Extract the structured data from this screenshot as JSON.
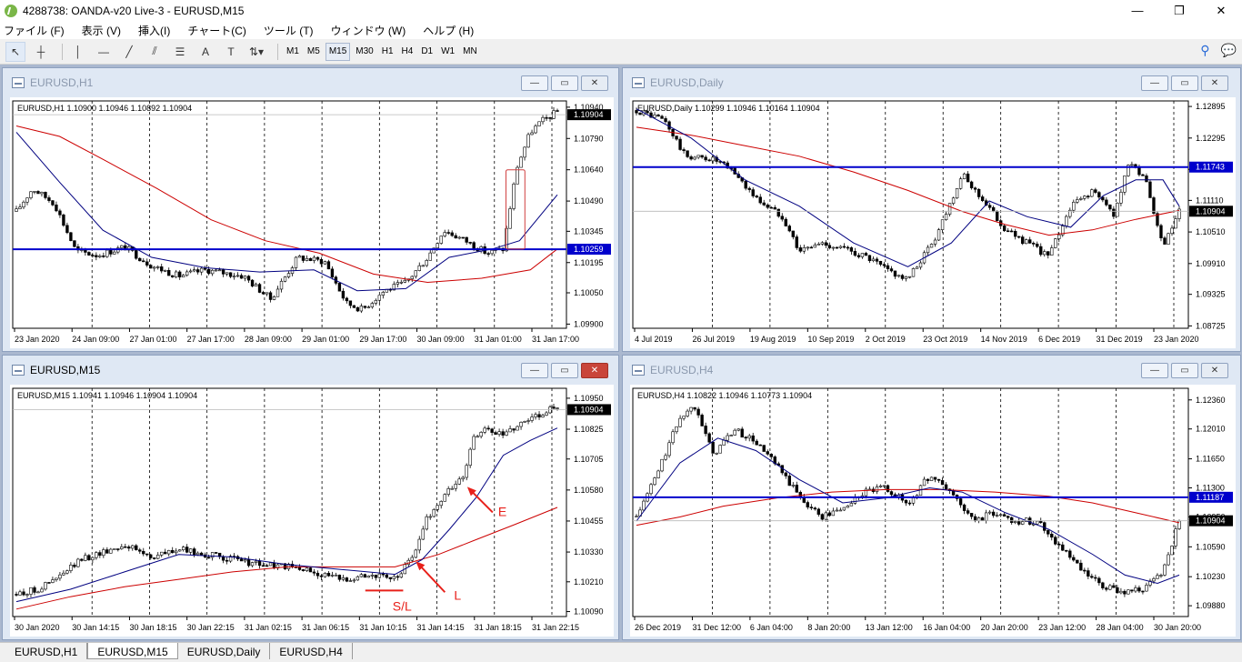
{
  "app": {
    "title": "4288738: OANDA-v20 Live-3 - EURUSD,M15",
    "win_min": "—",
    "win_max": "❐",
    "win_close": "✕"
  },
  "menu": [
    "ファイル (F)",
    "表示 (V)",
    "挿入(I)",
    "チャート(C)",
    "ツール (T)",
    "ウィンドウ (W)",
    "ヘルプ (H)"
  ],
  "toolbar": {
    "timeframes": [
      "M1",
      "M5",
      "M15",
      "M30",
      "H1",
      "H4",
      "D1",
      "W1",
      "MN"
    ],
    "selected_timeframe": "M15",
    "icons": [
      "cursor-icon",
      "crosshair-icon",
      "vertical-line-icon",
      "horizontal-line-icon",
      "trendline-icon",
      "fibonacci-icon",
      "channel-icon",
      "text-icon",
      "label-icon",
      "arrows-icon"
    ],
    "text_label": "A"
  },
  "window_tabs": {
    "tabs": [
      "EURUSD,H1",
      "EURUSD,M15",
      "EURUSD,Daily",
      "EURUSD,H4"
    ],
    "active": "EURUSD,M15"
  },
  "windows": [
    {
      "id": "h1",
      "title": "EURUSD,H1",
      "header": "EURUSD,H1  1.10900 1.10946 1.10892 1.10904",
      "active": false
    },
    {
      "id": "daily",
      "title": "EURUSD,Daily",
      "header": "EURUSD,Daily  1.10299 1.10946 1.10164 1.10904",
      "active": false
    },
    {
      "id": "m15",
      "title": "EURUSD,M15",
      "header": "EURUSD,M15  1.10941 1.10946 1.10904 1.10904",
      "active": true
    },
    {
      "id": "h4",
      "title": "EURUSD,H4",
      "header": "EURUSD,H4  1.10822 1.10946 1.10773 1.10904",
      "active": false
    }
  ],
  "colors": {
    "hline": "#0000cc",
    "ma_fast": "#000080",
    "ma_slow": "#cc0000",
    "annotation": "#e8201a",
    "price_tag_bg": "#000000",
    "hline_tag_bg": "#0000cc"
  },
  "chart_data": [
    {
      "id": "h1",
      "type": "candlestick",
      "ylim": [
        1.0988,
        1.1097
      ],
      "yticks": [
        "1.10940",
        "1.10790",
        "1.10640",
        "1.10490",
        "1.10345",
        "1.10195",
        "1.10050",
        "1.09900"
      ],
      "xlabels": [
        "23 Jan 2020",
        "24 Jan 09:00",
        "27 Jan 01:00",
        "27 Jan 17:00",
        "28 Jan 09:00",
        "29 Jan 01:00",
        "29 Jan 17:00",
        "30 Jan 09:00",
        "31 Jan 01:00",
        "31 Jan 17:00"
      ],
      "last_price": "1.10904",
      "hline": {
        "value": 1.10259,
        "label": "1.10259"
      },
      "close_path": [
        [
          0,
          1.1044
        ],
        [
          0.03,
          1.1055
        ],
        [
          0.07,
          1.1048
        ],
        [
          0.11,
          1.1025
        ],
        [
          0.15,
          1.1023
        ],
        [
          0.2,
          1.1027
        ],
        [
          0.25,
          1.1018
        ],
        [
          0.3,
          1.1013
        ],
        [
          0.35,
          1.1016
        ],
        [
          0.42,
          1.1013
        ],
        [
          0.47,
          1.1002
        ],
        [
          0.52,
          1.1022
        ],
        [
          0.57,
          1.102
        ],
        [
          0.61,
          1.1
        ],
        [
          0.64,
          1.0997
        ],
        [
          0.68,
          1.1006
        ],
        [
          0.72,
          1.101
        ],
        [
          0.76,
          1.1022
        ],
        [
          0.79,
          1.1035
        ],
        [
          0.83,
          1.103
        ],
        [
          0.87,
          1.1024
        ],
        [
          0.9,
          1.1026
        ],
        [
          0.925,
          1.1065
        ],
        [
          0.95,
          1.1082
        ],
        [
          0.97,
          1.1087
        ],
        [
          1,
          1.1092
        ]
      ],
      "ma_fast": [
        [
          0,
          1.1082
        ],
        [
          0.08,
          1.1058
        ],
        [
          0.16,
          1.1035
        ],
        [
          0.25,
          1.1022
        ],
        [
          0.35,
          1.1017
        ],
        [
          0.45,
          1.1015
        ],
        [
          0.55,
          1.1016
        ],
        [
          0.63,
          1.1006
        ],
        [
          0.72,
          1.1007
        ],
        [
          0.8,
          1.1022
        ],
        [
          0.88,
          1.1026
        ],
        [
          0.93,
          1.103
        ],
        [
          1,
          1.1052
        ]
      ],
      "ma_slow": [
        [
          0,
          1.1085
        ],
        [
          0.08,
          1.108
        ],
        [
          0.16,
          1.1069
        ],
        [
          0.26,
          1.1055
        ],
        [
          0.36,
          1.104
        ],
        [
          0.46,
          1.103
        ],
        [
          0.56,
          1.1024
        ],
        [
          0.66,
          1.1014
        ],
        [
          0.76,
          1.101
        ],
        [
          0.86,
          1.1012
        ],
        [
          0.95,
          1.1016
        ],
        [
          1,
          1.1026
        ]
      ],
      "box": {
        "x0": 0.905,
        "x1": 0.94,
        "y0": 1.1064,
        "y1": 1.1026
      }
    },
    {
      "id": "daily",
      "type": "candlestick",
      "ylim": [
        1.0868,
        1.13
      ],
      "yticks": [
        "1.12895",
        "1.12295",
        "1.11700",
        "1.11110",
        "1.10510",
        "1.09910",
        "1.09325",
        "1.08725"
      ],
      "xlabels": [
        "4 Jul 2019",
        "26 Jul 2019",
        "19 Aug 2019",
        "10 Sep 2019",
        "2 Oct 2019",
        "23 Oct 2019",
        "14 Nov 2019",
        "6 Dec 2019",
        "31 Dec 2019",
        "23 Jan 2020"
      ],
      "last_price": "1.10904",
      "hline": {
        "value": 1.11743,
        "label": "1.11743"
      },
      "close_path": [
        [
          0,
          1.1282
        ],
        [
          0.05,
          1.1265
        ],
        [
          0.09,
          1.1195
        ],
        [
          0.14,
          1.119
        ],
        [
          0.18,
          1.1165
        ],
        [
          0.22,
          1.1115
        ],
        [
          0.27,
          1.108
        ],
        [
          0.3,
          1.1015
        ],
        [
          0.34,
          1.103
        ],
        [
          0.38,
          1.102
        ],
        [
          0.42,
          1.1005
        ],
        [
          0.46,
          1.098
        ],
        [
          0.5,
          1.096
        ],
        [
          0.55,
          1.104
        ],
        [
          0.6,
          1.116
        ],
        [
          0.64,
          1.111
        ],
        [
          0.68,
          1.1055
        ],
        [
          0.72,
          1.103
        ],
        [
          0.76,
          1.1005
        ],
        [
          0.8,
          1.11
        ],
        [
          0.84,
          1.113
        ],
        [
          0.88,
          1.1085
        ],
        [
          0.91,
          1.119
        ],
        [
          0.94,
          1.114
        ],
        [
          0.97,
          1.102
        ],
        [
          1,
          1.109
        ]
      ],
      "ma_fast": [
        [
          0,
          1.1285
        ],
        [
          0.1,
          1.123
        ],
        [
          0.2,
          1.115
        ],
        [
          0.3,
          1.11
        ],
        [
          0.4,
          1.103
        ],
        [
          0.5,
          1.0985
        ],
        [
          0.58,
          1.103
        ],
        [
          0.65,
          1.111
        ],
        [
          0.72,
          1.108
        ],
        [
          0.8,
          1.106
        ],
        [
          0.86,
          1.112
        ],
        [
          0.92,
          1.115
        ],
        [
          0.97,
          1.115
        ],
        [
          1,
          1.11
        ]
      ],
      "ma_slow": [
        [
          0,
          1.125
        ],
        [
          0.1,
          1.1235
        ],
        [
          0.2,
          1.1215
        ],
        [
          0.3,
          1.1195
        ],
        [
          0.4,
          1.1165
        ],
        [
          0.5,
          1.113
        ],
        [
          0.6,
          1.109
        ],
        [
          0.68,
          1.1065
        ],
        [
          0.76,
          1.1045
        ],
        [
          0.84,
          1.1055
        ],
        [
          0.92,
          1.1075
        ],
        [
          1,
          1.1092
        ]
      ]
    },
    {
      "id": "m15",
      "type": "candlestick",
      "ylim": [
        1.1007,
        1.1099
      ],
      "yticks": [
        "1.10950",
        "1.10825",
        "1.10705",
        "1.10580",
        "1.10455",
        "1.10330",
        "1.10210",
        "1.10090"
      ],
      "xlabels": [
        "30 Jan 2020",
        "30 Jan 14:15",
        "30 Jan 18:15",
        "30 Jan 22:15",
        "31 Jan 02:15",
        "31 Jan 06:15",
        "31 Jan 10:15",
        "31 Jan 14:15",
        "31 Jan 18:15",
        "31 Jan 22:15"
      ],
      "last_price": "1.10904",
      "close_path": [
        [
          0,
          1.1016
        ],
        [
          0.04,
          1.1018
        ],
        [
          0.08,
          1.1023
        ],
        [
          0.12,
          1.103
        ],
        [
          0.16,
          1.1033
        ],
        [
          0.2,
          1.1036
        ],
        [
          0.25,
          1.1031
        ],
        [
          0.3,
          1.1034
        ],
        [
          0.35,
          1.1032
        ],
        [
          0.4,
          1.103
        ],
        [
          0.45,
          1.1028
        ],
        [
          0.5,
          1.1027
        ],
        [
          0.55,
          1.1025
        ],
        [
          0.6,
          1.1022
        ],
        [
          0.65,
          1.1024
        ],
        [
          0.7,
          1.1022
        ],
        [
          0.73,
          1.103
        ],
        [
          0.76,
          1.1047
        ],
        [
          0.8,
          1.1058
        ],
        [
          0.83,
          1.1065
        ],
        [
          0.845,
          1.108
        ],
        [
          0.87,
          1.1082
        ],
        [
          0.9,
          1.108
        ],
        [
          0.93,
          1.1085
        ],
        [
          0.96,
          1.1088
        ],
        [
          1,
          1.1092
        ]
      ],
      "ma_fast": [
        [
          0,
          1.1013
        ],
        [
          0.1,
          1.1018
        ],
        [
          0.2,
          1.1025
        ],
        [
          0.3,
          1.1032
        ],
        [
          0.4,
          1.1031
        ],
        [
          0.5,
          1.1028
        ],
        [
          0.6,
          1.1026
        ],
        [
          0.7,
          1.1024
        ],
        [
          0.75,
          1.103
        ],
        [
          0.8,
          1.1042
        ],
        [
          0.85,
          1.1055
        ],
        [
          0.9,
          1.1072
        ],
        [
          0.95,
          1.1078
        ],
        [
          1,
          1.1083
        ]
      ],
      "ma_slow": [
        [
          0,
          1.101
        ],
        [
          0.1,
          1.1015
        ],
        [
          0.2,
          1.1019
        ],
        [
          0.3,
          1.1022
        ],
        [
          0.4,
          1.1025
        ],
        [
          0.5,
          1.1027
        ],
        [
          0.6,
          1.1027
        ],
        [
          0.7,
          1.1027
        ],
        [
          0.78,
          1.1032
        ],
        [
          0.85,
          1.1038
        ],
        [
          0.92,
          1.1044
        ],
        [
          1,
          1.1051
        ]
      ],
      "labels": [
        "E",
        "L",
        "S/L"
      ]
    },
    {
      "id": "h4",
      "type": "candlestick",
      "ylim": [
        1.0975,
        1.125
      ],
      "yticks": [
        "1.12360",
        "1.12010",
        "1.11650",
        "1.11300",
        "1.10950",
        "1.10590",
        "1.10230",
        "1.09880"
      ],
      "xlabels": [
        "26 Dec 2019",
        "31 Dec 12:00",
        "6 Jan 04:00",
        "8 Jan 20:00",
        "13 Jan 12:00",
        "16 Jan 04:00",
        "20 Jan 20:00",
        "23 Jan 12:00",
        "28 Jan 04:00",
        "30 Jan 20:00"
      ],
      "last_price": "1.10904",
      "hline": {
        "value": 1.11187,
        "label": "1.11187"
      },
      "close_path": [
        [
          0,
          1.1095
        ],
        [
          0.04,
          1.115
        ],
        [
          0.08,
          1.1215
        ],
        [
          0.11,
          1.123
        ],
        [
          0.14,
          1.117
        ],
        [
          0.18,
          1.12
        ],
        [
          0.22,
          1.1185
        ],
        [
          0.26,
          1.1155
        ],
        [
          0.3,
          1.112
        ],
        [
          0.34,
          1.1095
        ],
        [
          0.38,
          1.1105
        ],
        [
          0.42,
          1.1125
        ],
        [
          0.46,
          1.113
        ],
        [
          0.5,
          1.111
        ],
        [
          0.54,
          1.1145
        ],
        [
          0.58,
          1.1125
        ],
        [
          0.62,
          1.109
        ],
        [
          0.66,
          1.11
        ],
        [
          0.7,
          1.109
        ],
        [
          0.74,
          1.109
        ],
        [
          0.78,
          1.106
        ],
        [
          0.82,
          1.103
        ],
        [
          0.86,
          1.101
        ],
        [
          0.9,
          1.1005
        ],
        [
          0.94,
          1.101
        ],
        [
          0.97,
          1.103
        ],
        [
          1,
          1.109
        ]
      ],
      "ma_fast": [
        [
          0,
          1.109
        ],
        [
          0.08,
          1.116
        ],
        [
          0.15,
          1.119
        ],
        [
          0.22,
          1.1175
        ],
        [
          0.3,
          1.114
        ],
        [
          0.38,
          1.1112
        ],
        [
          0.46,
          1.1118
        ],
        [
          0.54,
          1.113
        ],
        [
          0.6,
          1.1125
        ],
        [
          0.68,
          1.11
        ],
        [
          0.76,
          1.108
        ],
        [
          0.84,
          1.105
        ],
        [
          0.9,
          1.1025
        ],
        [
          0.96,
          1.1015
        ],
        [
          1,
          1.1025
        ]
      ],
      "ma_slow": [
        [
          0,
          1.1085
        ],
        [
          0.08,
          1.1095
        ],
        [
          0.16,
          1.1108
        ],
        [
          0.26,
          1.1118
        ],
        [
          0.36,
          1.1125
        ],
        [
          0.46,
          1.1128
        ],
        [
          0.56,
          1.1128
        ],
        [
          0.66,
          1.1125
        ],
        [
          0.76,
          1.112
        ],
        [
          0.84,
          1.1112
        ],
        [
          0.92,
          1.11
        ],
        [
          1,
          1.1088
        ]
      ]
    }
  ]
}
